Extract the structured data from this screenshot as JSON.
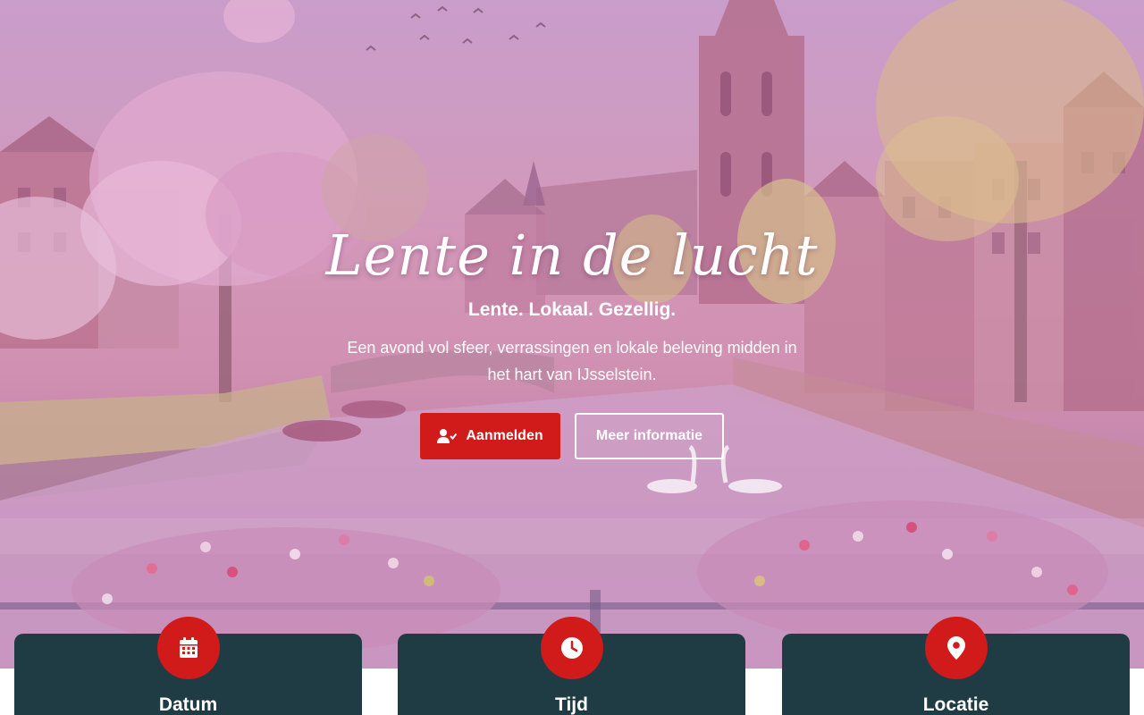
{
  "hero": {
    "title": "Lente in de lucht",
    "subtitle": "Lente. Lokaal. Gezellig.",
    "text": "Een avond vol sfeer, verrassingen en lokale beleving midden in het hart van IJsselstein.",
    "primary_button": "Aanmelden",
    "secondary_button": "Meer informatie"
  },
  "cards": [
    {
      "label": "Datum",
      "icon": "calendar-icon"
    },
    {
      "label": "Tijd",
      "icon": "clock-icon"
    },
    {
      "label": "Locatie",
      "icon": "location-pin-icon"
    }
  ],
  "colors": {
    "accent": "#d11a1a",
    "card_bg": "#1f3c45",
    "overlay": "#c99ac4"
  }
}
